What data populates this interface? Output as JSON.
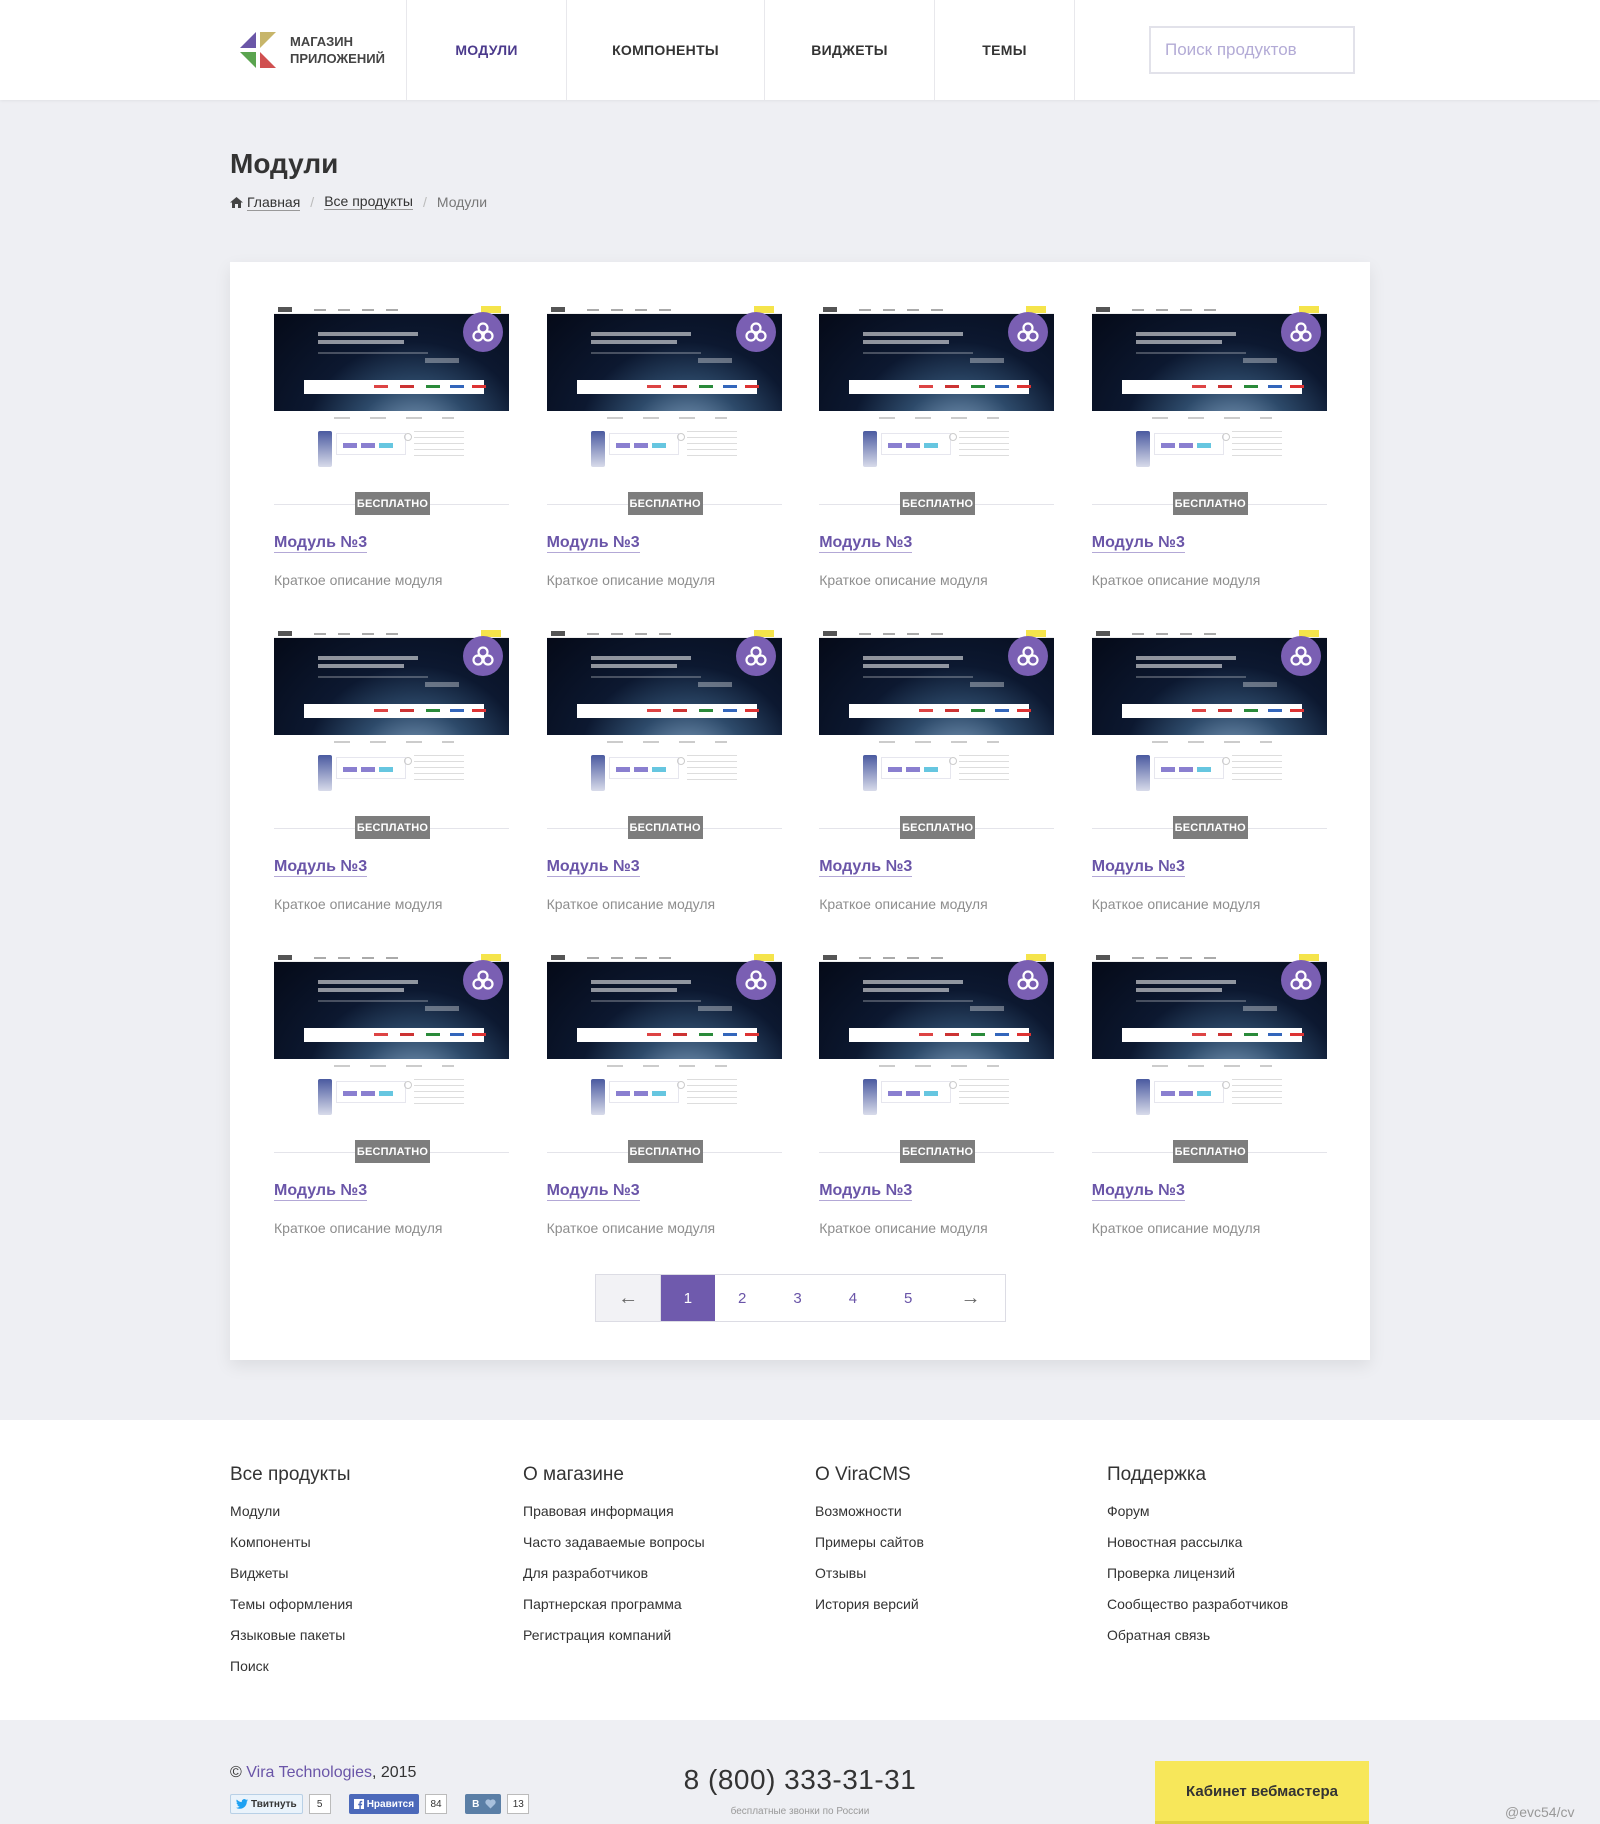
{
  "header": {
    "logo_line1": "МАГАЗИН",
    "logo_line2": "ПРИЛОЖЕНИЙ",
    "nav": [
      {
        "label": "МОДУЛИ",
        "active": true
      },
      {
        "label": "КОМПОНЕНТЫ",
        "active": false
      },
      {
        "label": "ВИДЖЕТЫ",
        "active": false
      },
      {
        "label": "ТЕМЫ",
        "active": false
      }
    ],
    "search_placeholder": "Поиск продуктов"
  },
  "page": {
    "title": "Модули",
    "breadcrumb": [
      "Главная",
      "Все продукты",
      "Модули"
    ]
  },
  "products": [
    {
      "price": "БЕСПЛАТНО",
      "title": "Модуль №3",
      "desc": "Краткое описание модуля"
    },
    {
      "price": "БЕСПЛАТНО",
      "title": "Модуль №3",
      "desc": "Краткое описание модуля"
    },
    {
      "price": "БЕСПЛАТНО",
      "title": "Модуль №3",
      "desc": "Краткое описание модуля"
    },
    {
      "price": "БЕСПЛАТНО",
      "title": "Модуль №3",
      "desc": "Краткое описание модуля"
    },
    {
      "price": "БЕСПЛАТНО",
      "title": "Модуль №3",
      "desc": "Краткое описание модуля"
    },
    {
      "price": "БЕСПЛАТНО",
      "title": "Модуль №3",
      "desc": "Краткое описание модуля"
    },
    {
      "price": "БЕСПЛАТНО",
      "title": "Модуль №3",
      "desc": "Краткое описание модуля"
    },
    {
      "price": "БЕСПЛАТНО",
      "title": "Модуль №3",
      "desc": "Краткое описание модуля"
    },
    {
      "price": "БЕСПЛАТНО",
      "title": "Модуль №3",
      "desc": "Краткое описание модуля"
    },
    {
      "price": "БЕСПЛАТНО",
      "title": "Модуль №3",
      "desc": "Краткое описание модуля"
    },
    {
      "price": "БЕСПЛАТНО",
      "title": "Модуль №3",
      "desc": "Краткое описание модуля"
    },
    {
      "price": "БЕСПЛАТНО",
      "title": "Модуль №3",
      "desc": "Краткое описание модуля"
    }
  ],
  "pagination": {
    "prev": "←",
    "pages": [
      "1",
      "2",
      "3",
      "4",
      "5"
    ],
    "current": "1",
    "next": "→"
  },
  "footer": {
    "columns": [
      {
        "title": "Все продукты",
        "links": [
          "Модули",
          "Компоненты",
          "Виджеты",
          "Темы оформления",
          "Языковые пакеты",
          "Поиск"
        ]
      },
      {
        "title": "О магазине",
        "links": [
          "Правовая информация",
          "Часто задаваемые вопросы",
          "Для разработчиков",
          "Партнерская программа",
          "Регистрация компаний"
        ]
      },
      {
        "title": "О ViraCMS",
        "links": [
          "Возможности",
          "Примеры сайтов",
          "Отзывы",
          "История версий"
        ]
      },
      {
        "title": "Поддержка",
        "links": [
          "Форум",
          "Новостная рассылка",
          "Проверка лицензий",
          "Сообщество разработчиков",
          "Обратная связь"
        ]
      }
    ],
    "copyright_symbol": "©",
    "copyright_brand": "Vira Technologies",
    "copyright_year": ", 2015",
    "social": [
      {
        "label": "Твитнуть",
        "count": "5"
      },
      {
        "label": "Нравится",
        "count": "84"
      },
      {
        "label": "В",
        "count": "13"
      }
    ],
    "phone": "8 (800) 333-31-31",
    "phone_note": "бесплатные звонки по России",
    "cabinet_button": "Кабинет вебмастера",
    "handle": "@evc54/cv"
  },
  "colors": {
    "accent": "#6f5aad",
    "cta": "#f7e75a",
    "badge": "#7d7d7d"
  }
}
